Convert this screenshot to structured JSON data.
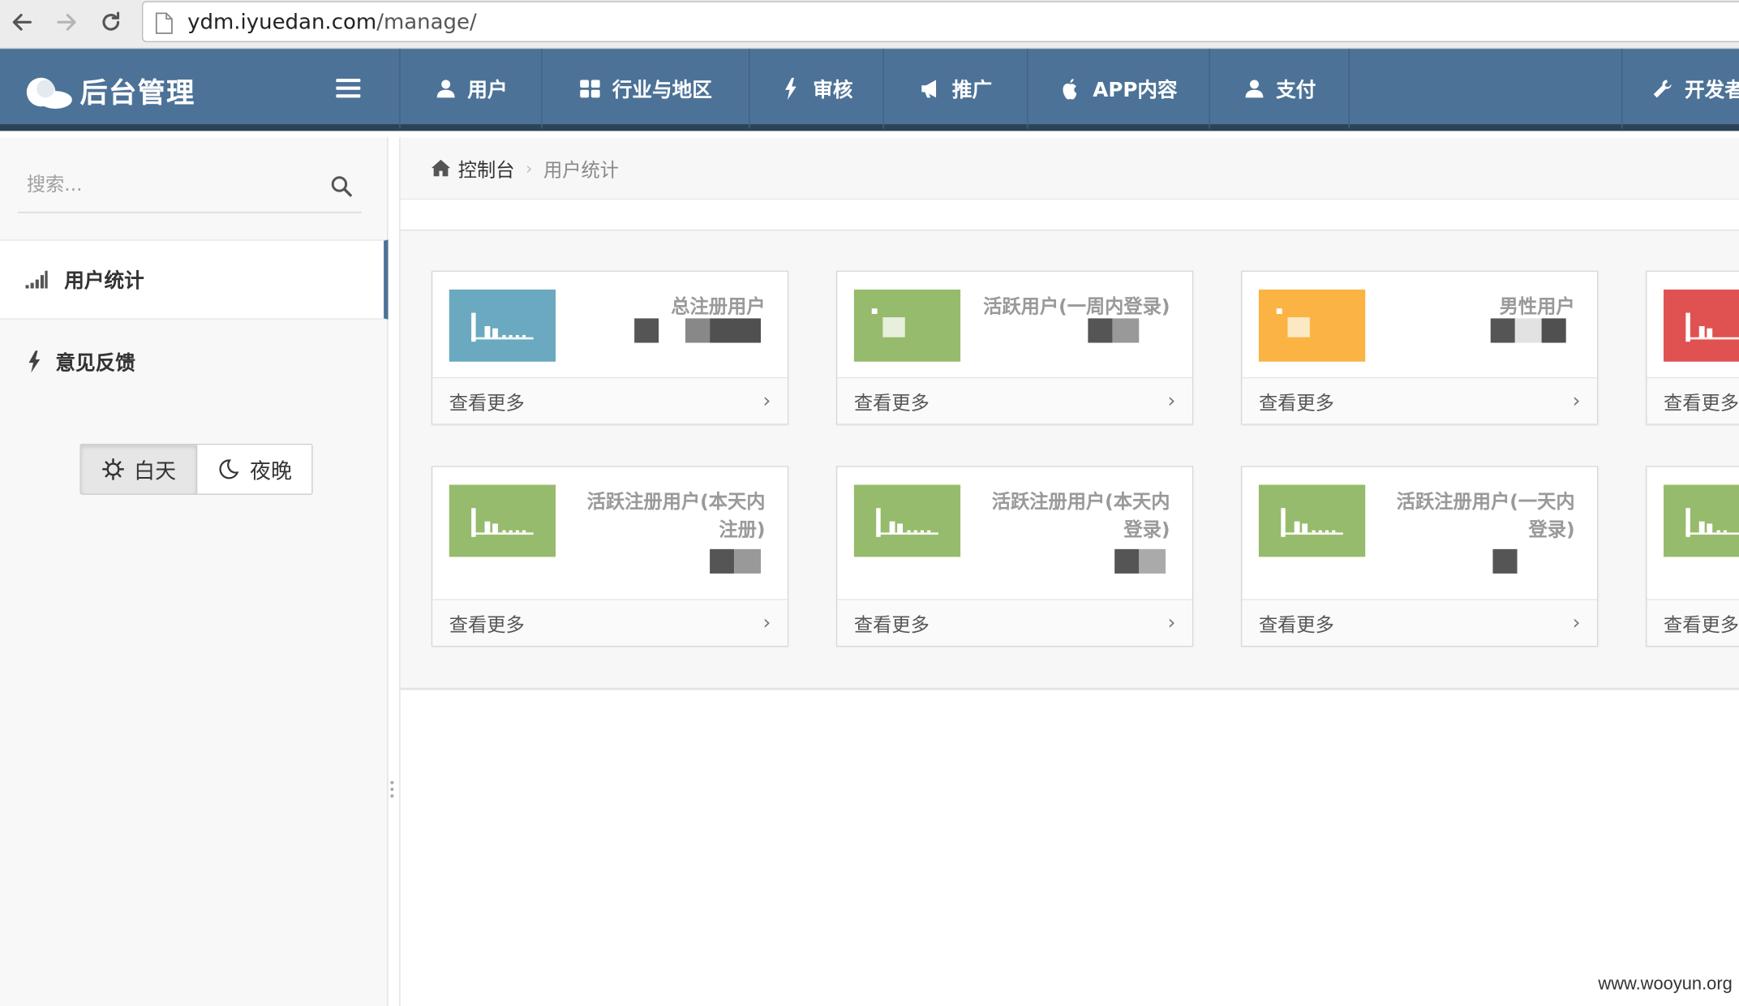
{
  "browser": {
    "url_host": "ydm.iyuedan.com",
    "url_path": "/manage/"
  },
  "header": {
    "title": "后台管理",
    "nav": [
      {
        "label": "用户",
        "icon": "user-icon"
      },
      {
        "label": "行业与地区",
        "icon": "grid-icon"
      },
      {
        "label": "审核",
        "icon": "bolt-icon"
      },
      {
        "label": "推广",
        "icon": "bullhorn-icon"
      },
      {
        "label": "APP内容",
        "icon": "apple-icon"
      },
      {
        "label": "支付",
        "icon": "user-icon"
      }
    ],
    "right_nav": {
      "label": "开发者",
      "icon": "wrench-icon"
    }
  },
  "sidebar": {
    "search_placeholder": "搜索...",
    "items": [
      {
        "label": "用户统计",
        "icon": "signal-icon",
        "active": true
      },
      {
        "label": "意见反馈",
        "icon": "bolt-icon",
        "active": false
      }
    ],
    "theme": {
      "day_label": "白天",
      "night_label": "夜晚",
      "selected": "白天"
    }
  },
  "breadcrumb": {
    "home": "控制台",
    "current": "用户统计"
  },
  "cards": [
    {
      "title": "总注册用户",
      "color": "#6aa9bf",
      "footer": "查看更多"
    },
    {
      "title": "活跃用户(一周内登录)",
      "color": "#96bb6c",
      "footer": "查看更多"
    },
    {
      "title": "男性用户",
      "color": "#fbb344",
      "footer": "查看更多"
    },
    {
      "title": "",
      "color": "#e05252",
      "footer": "查看更多"
    },
    {
      "title": "活跃注册用户(本天内注册)",
      "color": "#96bb6c",
      "footer": "查看更多"
    },
    {
      "title": "活跃注册用户(本天内登录)",
      "color": "#96bb6c",
      "footer": "查看更多"
    },
    {
      "title": "活跃注册用户(一天内登录)",
      "color": "#96bb6c",
      "footer": "查看更多"
    },
    {
      "title": "",
      "color": "#96bb6c",
      "footer": "查看更多"
    }
  ],
  "watermark": "www.wooyun.org",
  "colors": {
    "header_bg": "#4c7297",
    "header_border": "#2d4257",
    "sidebar_bg": "#f8f8f8",
    "accent": "#4c7297"
  }
}
